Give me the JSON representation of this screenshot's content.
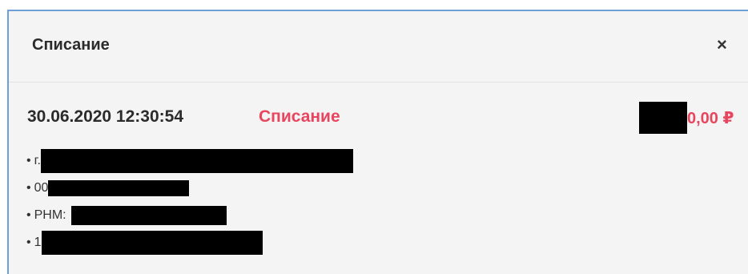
{
  "modal": {
    "title": "Списание",
    "close_symbol": "×"
  },
  "operation": {
    "datetime": "30.06.2020 12:30:54",
    "type": "Списание",
    "amount": "0,00 ₽"
  },
  "details": [
    {
      "bullet": "•",
      "text": "г."
    },
    {
      "bullet": "•",
      "text": "00"
    },
    {
      "bullet": "•",
      "text": "РНМ:"
    },
    {
      "bullet": "•",
      "text": "1"
    }
  ],
  "colors": {
    "accent_red": "#e8455e",
    "border_blue": "#6e9fd8",
    "background": "#f4f4f4"
  }
}
